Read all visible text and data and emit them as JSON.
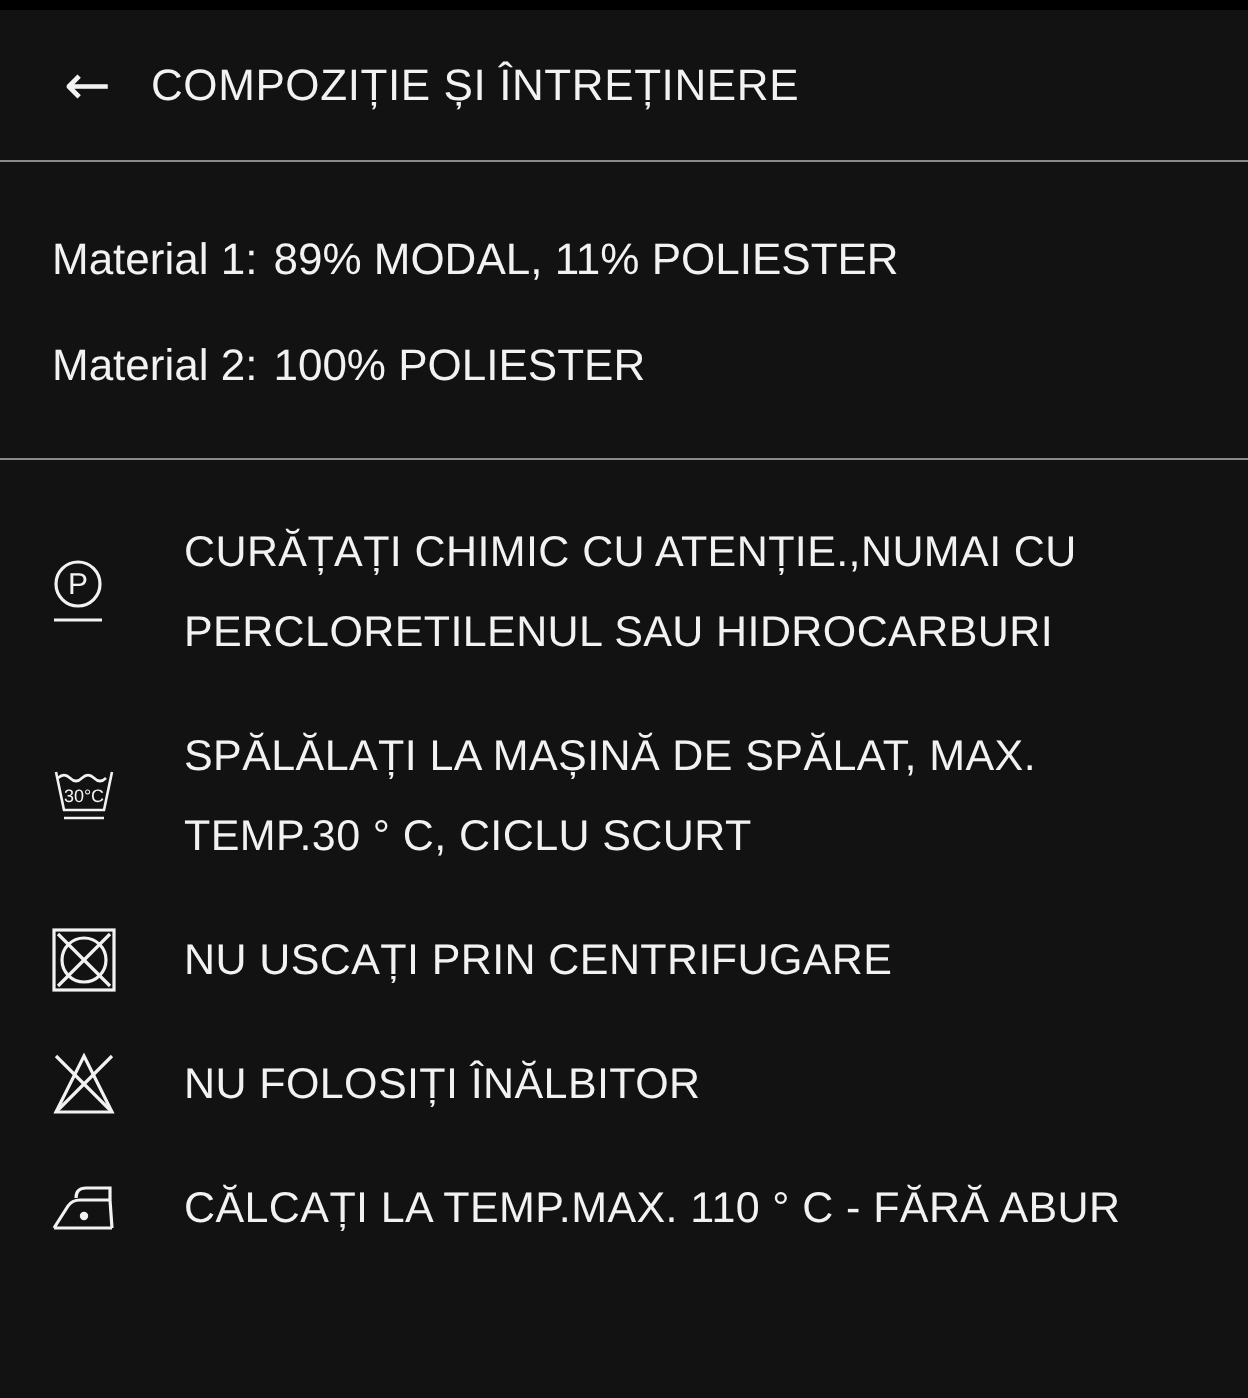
{
  "header": {
    "back": "←",
    "title": "COMPOZIȚIE ȘI ÎNTREȚINERE"
  },
  "materials": [
    {
      "label": "Material 1:",
      "value": "89% MODAL, 11% POLIESTER"
    },
    {
      "label": "Material 2:",
      "value": "100% POLIESTER"
    }
  ],
  "care": [
    {
      "kind": "dry-clean",
      "symbol": "P",
      "text": "CURĂȚAȚI CHIMIC CU ATENȚIE.,NUMAI CU PERCLORETILENUL SAU HIDROCARBURI"
    },
    {
      "kind": "wash",
      "symbol": "30°C",
      "text": "SPĂLĂLAȚI LA MAȘINĂ DE SPĂLAT, MAX. TEMP.30 ° C, CICLU SCURT"
    },
    {
      "kind": "no-tumble",
      "text": "NU USCAȚI PRIN CENTRIFUGARE"
    },
    {
      "kind": "no-bleach",
      "text": "NU FOLOSIȚI ÎNĂLBITOR"
    },
    {
      "kind": "iron",
      "text": "CĂLCAȚI LA TEMP.MAX. 110 ° C - FĂRĂ ABUR"
    }
  ]
}
